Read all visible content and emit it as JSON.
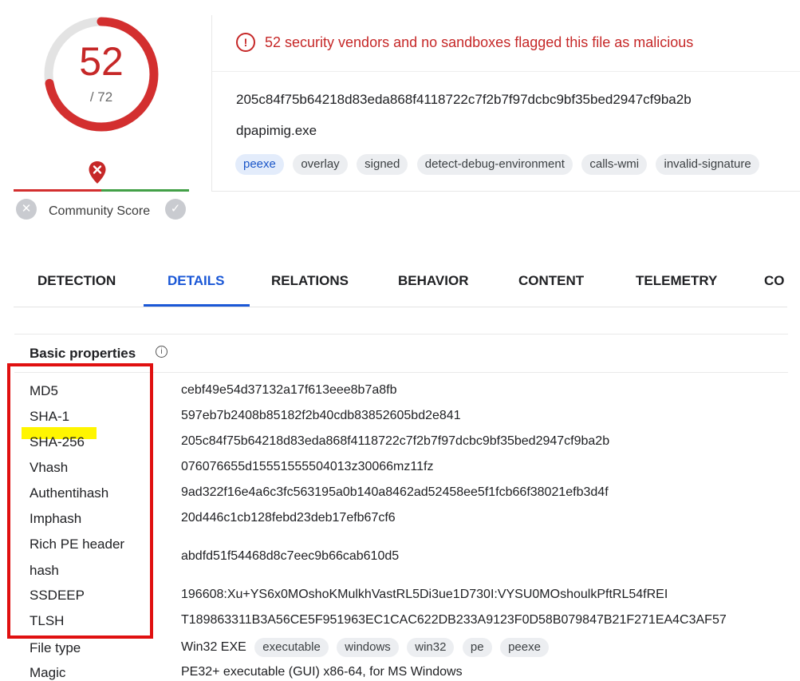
{
  "score": {
    "value": "52",
    "total": "/ 72",
    "fraction": 0.722,
    "community_label": "Community Score"
  },
  "summary": {
    "alert": "52 security vendors and no sandboxes flagged this file as malicious",
    "sha256": "205c84f75b64218d83eda868f4118722c7f2b7f97dcbc9bf35bed2947cf9ba2b",
    "filename": "dpapimig.exe",
    "tags": [
      "peexe",
      "overlay",
      "signed",
      "detect-debug-environment",
      "calls-wmi",
      "invalid-signature"
    ]
  },
  "tabs": [
    {
      "label": "DETECTION",
      "active": false
    },
    {
      "label": "DETAILS",
      "active": true
    },
    {
      "label": "RELATIONS",
      "active": false
    },
    {
      "label": "BEHAVIOR",
      "active": false
    },
    {
      "label": "CONTENT",
      "active": false
    },
    {
      "label": "TELEMETRY",
      "active": false
    },
    {
      "label": "CO",
      "active": false
    }
  ],
  "basic": {
    "title": "Basic properties",
    "rows": [
      {
        "label": "MD5",
        "value": "cebf49e54d37132a17f613eee8b7a8fb"
      },
      {
        "label": "SHA-1",
        "value": "597eb7b2408b85182f2b40cdb83852605bd2e841"
      },
      {
        "label": "SHA-256",
        "value": "205c84f75b64218d83eda868f4118722c7f2b7f97dcbc9bf35bed2947cf9ba2b"
      },
      {
        "label": "Vhash",
        "value": "076076655d15551555504013z30066mz11fz"
      },
      {
        "label": "Authentihash",
        "value": "9ad322f16e4a6c3fc563195a0b140a8462ad52458ee5f1fcb66f38021efb3d4f"
      },
      {
        "label": "Imphash",
        "value": "20d446c1cb128febd23deb17efb67cf6"
      },
      {
        "label": "Rich PE header hash",
        "label_line1": "Rich PE header",
        "label_line2": "hash",
        "value": "abdfd51f54468d8c7eec9b66cab610d5"
      },
      {
        "label": "SSDEEP",
        "value": "196608:Xu+YS6x0MOshoKMulkhVastRL5Di3ue1D730I:VYSU0MOshoulkPftRL54fREI"
      },
      {
        "label": "TLSH",
        "value": "T189863311B3A56CE5F951963EC1CAC622DB233A9123F0D58B079847B21F271EA4C3AF57"
      }
    ],
    "file_type": {
      "label": "File type",
      "value": "Win32 EXE",
      "tags": [
        "executable",
        "windows",
        "win32",
        "pe",
        "peexe"
      ]
    },
    "magic": {
      "label": "Magic",
      "value": "PE32+ executable (GUI) x86-64, for MS Windows"
    }
  },
  "colors": {
    "malicious": "#c62828",
    "accent": "#1a57d6",
    "annotation_box": "#e01010",
    "highlight": "#fff500"
  }
}
